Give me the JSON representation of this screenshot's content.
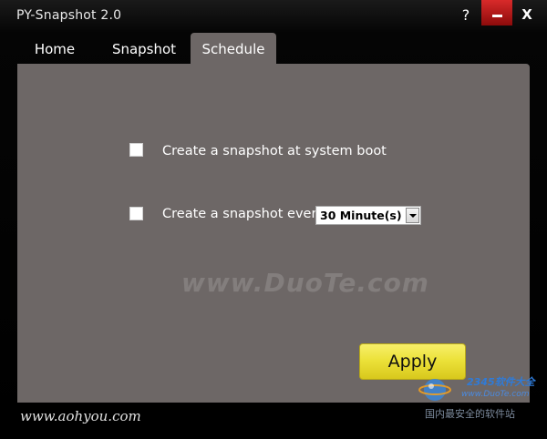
{
  "window": {
    "title": "PY-Snapshot 2.0",
    "help_label": "?",
    "close_label": "X"
  },
  "tabs": [
    {
      "label": "Home"
    },
    {
      "label": "Snapshot"
    },
    {
      "label": "Schedule",
      "selected": true
    }
  ],
  "schedule": {
    "boot_option": {
      "label": "Create a snapshot at system boot",
      "checked": false
    },
    "interval_option": {
      "label": "Create a snapshot every",
      "checked": false
    },
    "interval_select": {
      "value": "30 Minute(s)"
    },
    "apply_label": "Apply"
  },
  "footer": {
    "url": "www.aohyou.com"
  },
  "watermarks": {
    "center": "www.DuoTe.com",
    "logo_text": "2345软件大全",
    "logo_sub": "www.DuoTe.com",
    "site": "国内最安全的软件站"
  },
  "colors": {
    "panel_bg": "#6d6766",
    "minimize_red": "#c41e1e",
    "apply_yellow": "#ece23a"
  }
}
